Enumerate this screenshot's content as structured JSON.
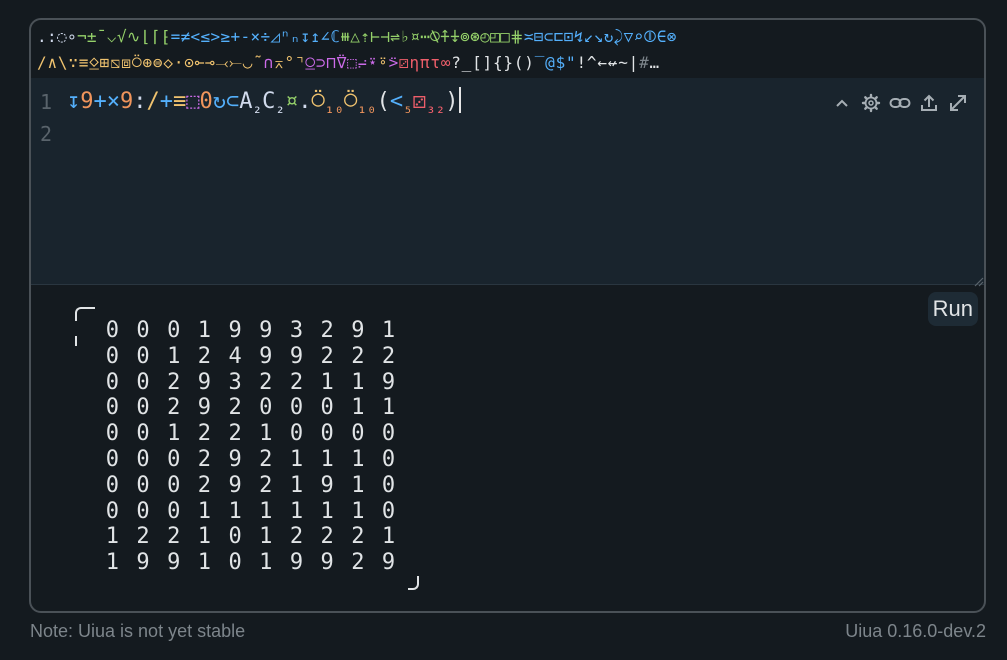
{
  "colors": {
    "number": "#f0955c",
    "monadic_function": "#95d16a",
    "dyadic_function": "#54b0fc",
    "monadic_modifier": "#f0c36f",
    "dyadic_modifier": "#cc6be9",
    "constant": "#ed5e6a",
    "stack": "#d1daec",
    "text": "#e1e4e6",
    "muted": "#7d858b"
  },
  "glyph_rows": [
    [
      {
        "c": ".",
        "k": "stack"
      },
      {
        "c": ":",
        "k": "stack"
      },
      {
        "c": "◌",
        "k": "stack"
      },
      {
        "c": "∘",
        "k": "stack"
      },
      {
        "c": "¬",
        "k": "monadic_function"
      },
      {
        "c": "±",
        "k": "monadic_function"
      },
      {
        "c": "¯",
        "k": "monadic_function"
      },
      {
        "c": "⌵",
        "k": "monadic_function"
      },
      {
        "c": "√",
        "k": "monadic_function"
      },
      {
        "c": "∿",
        "k": "monadic_function"
      },
      {
        "c": "⌊",
        "k": "monadic_function"
      },
      {
        "c": "⌈",
        "k": "monadic_function"
      },
      {
        "c": "⁅",
        "k": "monadic_function"
      },
      {
        "c": "=",
        "k": "dyadic_function"
      },
      {
        "c": "≠",
        "k": "dyadic_function"
      },
      {
        "c": "<",
        "k": "dyadic_function"
      },
      {
        "c": "≤",
        "k": "dyadic_function"
      },
      {
        "c": ">",
        "k": "dyadic_function"
      },
      {
        "c": "≥",
        "k": "dyadic_function"
      },
      {
        "c": "+",
        "k": "dyadic_function"
      },
      {
        "c": "-",
        "k": "dyadic_function"
      },
      {
        "c": "×",
        "k": "dyadic_function"
      },
      {
        "c": "÷",
        "k": "dyadic_function"
      },
      {
        "c": "◿",
        "k": "dyadic_function"
      },
      {
        "c": "ⁿ",
        "k": "dyadic_function"
      },
      {
        "c": "ₙ",
        "k": "dyadic_function"
      },
      {
        "c": "↧",
        "k": "dyadic_function"
      },
      {
        "c": "↥",
        "k": "dyadic_function"
      },
      {
        "c": "∠",
        "k": "dyadic_function"
      },
      {
        "c": "ℂ",
        "k": "dyadic_function"
      },
      {
        "c": "⧻",
        "k": "monadic_function"
      },
      {
        "c": "△",
        "k": "monadic_function"
      },
      {
        "c": "⇡",
        "k": "monadic_function"
      },
      {
        "c": "⊢",
        "k": "monadic_function"
      },
      {
        "c": "⊣",
        "k": "monadic_function"
      },
      {
        "c": "⇌",
        "k": "monadic_function"
      },
      {
        "c": "♭",
        "k": "monadic_function"
      },
      {
        "c": "¤",
        "k": "monadic_function"
      },
      {
        "c": "⋯",
        "k": "monadic_function"
      },
      {
        "c": "⍉",
        "k": "monadic_function"
      },
      {
        "c": "⍏",
        "k": "monadic_function"
      },
      {
        "c": "⍖",
        "k": "monadic_function"
      },
      {
        "c": "⊚",
        "k": "monadic_function"
      },
      {
        "c": "⊛",
        "k": "monadic_function"
      },
      {
        "c": "◴",
        "k": "monadic_function"
      },
      {
        "c": "◰",
        "k": "monadic_function"
      },
      {
        "c": "□",
        "k": "monadic_function"
      },
      {
        "c": "⋕",
        "k": "monadic_function"
      },
      {
        "c": "≍",
        "k": "dyadic_function"
      },
      {
        "c": "⊟",
        "k": "dyadic_function"
      },
      {
        "c": "⊂",
        "k": "dyadic_function"
      },
      {
        "c": "⊏",
        "k": "dyadic_function"
      },
      {
        "c": "⊡",
        "k": "dyadic_function"
      },
      {
        "c": "↯",
        "k": "dyadic_function"
      },
      {
        "c": "↙",
        "k": "dyadic_function"
      },
      {
        "c": "↘",
        "k": "dyadic_function"
      },
      {
        "c": "↻",
        "k": "dyadic_function"
      },
      {
        "c": "⤸",
        "k": "dyadic_function"
      },
      {
        "c": "▽",
        "k": "dyadic_function"
      },
      {
        "c": "⌕",
        "k": "dyadic_function"
      },
      {
        "c": "⦷",
        "k": "dyadic_function"
      },
      {
        "c": "∈",
        "k": "dyadic_function"
      },
      {
        "c": "⊗",
        "k": "dyadic_function"
      }
    ],
    [
      {
        "c": "/",
        "k": "monadic_modifier"
      },
      {
        "c": "∧",
        "k": "monadic_modifier"
      },
      {
        "c": "\\",
        "k": "monadic_modifier"
      },
      {
        "c": "∵",
        "k": "monadic_modifier"
      },
      {
        "c": "≡",
        "k": "monadic_modifier"
      },
      {
        "c": "⍚",
        "k": "monadic_modifier"
      },
      {
        "c": "⊞",
        "k": "monadic_modifier"
      },
      {
        "c": "⧅",
        "k": "monadic_modifier"
      },
      {
        "c": "⧈",
        "k": "monadic_modifier"
      },
      {
        "c": "⍥",
        "k": "monadic_modifier"
      },
      {
        "c": "⊕",
        "k": "monadic_modifier"
      },
      {
        "c": "⊜",
        "k": "monadic_modifier"
      },
      {
        "c": "◇",
        "k": "monadic_modifier"
      },
      {
        "c": "⋅",
        "k": "monadic_modifier"
      },
      {
        "c": "⊙",
        "k": "monadic_modifier"
      },
      {
        "c": "⟜",
        "k": "monadic_modifier"
      },
      {
        "c": "⊸",
        "k": "monadic_modifier"
      },
      {
        "c": "⤙",
        "k": "monadic_modifier"
      },
      {
        "c": "⤚",
        "k": "monadic_modifier"
      },
      {
        "c": "◡",
        "k": "monadic_modifier"
      },
      {
        "c": "˜",
        "k": "monadic_modifier"
      },
      {
        "c": "∩",
        "k": "dyadic_modifier"
      },
      {
        "c": "⌅",
        "k": "monadic_modifier"
      },
      {
        "c": "°",
        "k": "monadic_modifier"
      },
      {
        "c": "⌝",
        "k": "monadic_modifier"
      },
      {
        "c": "⍜",
        "k": "dyadic_modifier"
      },
      {
        "c": "⊃",
        "k": "dyadic_modifier"
      },
      {
        "c": "⊓",
        "k": "dyadic_modifier"
      },
      {
        "c": "⍢",
        "k": "dyadic_modifier"
      },
      {
        "c": "⬚",
        "k": "dyadic_modifier"
      },
      {
        "c": "⨬",
        "k": "dyadic_modifier"
      },
      {
        "c": "⍣",
        "k": "dyadic_modifier"
      },
      {
        "c": "⍤",
        "k": "monadic_modifier"
      },
      {
        "c": "⍩",
        "k": "dyadic_modifier"
      },
      {
        "c": "⚂",
        "k": "constant"
      },
      {
        "c": "η",
        "k": "constant"
      },
      {
        "c": "π",
        "k": "constant"
      },
      {
        "c": "τ",
        "k": "constant"
      },
      {
        "c": "∞",
        "k": "constant"
      },
      {
        "c": "?",
        "k": "text"
      },
      {
        "c": "_",
        "k": "text"
      },
      {
        "c": "[",
        "k": "text"
      },
      {
        "c": "]",
        "k": "text"
      },
      {
        "c": "{",
        "k": "text"
      },
      {
        "c": "}",
        "k": "text"
      },
      {
        "c": "(",
        "k": "text"
      },
      {
        "c": ")",
        "k": "text"
      },
      {
        "c": "‾",
        "k": "dyadic_function"
      },
      {
        "c": "@",
        "k": "dyadic_function"
      },
      {
        "c": "$",
        "k": "dyadic_function"
      },
      {
        "c": "\"",
        "k": "dyadic_function"
      },
      {
        "c": "!",
        "k": "text"
      },
      {
        "c": "^",
        "k": "text"
      },
      {
        "c": "←",
        "k": "text"
      },
      {
        "c": "↚",
        "k": "text"
      },
      {
        "c": "~",
        "k": "text"
      },
      {
        "c": "|",
        "k": "text"
      },
      {
        "c": "#",
        "k": "muted"
      },
      {
        "c": "…",
        "k": "text"
      }
    ]
  ],
  "line_numbers": [
    "1",
    "2"
  ],
  "code_tokens": [
    {
      "t": "↧",
      "k": "dyadic_function"
    },
    {
      "t": "9",
      "k": "number"
    },
    {
      "t": "+",
      "k": "dyadic_function"
    },
    {
      "t": "×",
      "k": "dyadic_function"
    },
    {
      "t": "9",
      "k": "number"
    },
    {
      "t": ":",
      "k": "stack"
    },
    {
      "t": "/",
      "k": "monadic_modifier"
    },
    {
      "t": "+",
      "k": "dyadic_function"
    },
    {
      "t": "≡",
      "k": "monadic_modifier"
    },
    {
      "t": "⬚",
      "k": "dyadic_modifier"
    },
    {
      "t": "0",
      "k": "number"
    },
    {
      "t": "↻",
      "k": "dyadic_function"
    },
    {
      "t": "⊂",
      "k": "dyadic_function"
    },
    {
      "t": "A",
      "k": "stack"
    },
    {
      "t": "₂",
      "k": "stack",
      "sub": true
    },
    {
      "t": "C",
      "k": "stack"
    },
    {
      "t": "₂",
      "k": "stack",
      "sub": true
    },
    {
      "t": "¤",
      "k": "monadic_function"
    },
    {
      "t": ".",
      "k": "stack"
    },
    {
      "t": "⍥",
      "k": "monadic_modifier"
    },
    {
      "t": "₁₀",
      "k": "number",
      "sub": true
    },
    {
      "t": "⍥",
      "k": "monadic_modifier"
    },
    {
      "t": "₁₀",
      "k": "number",
      "sub": true
    },
    {
      "t": "(",
      "k": "text"
    },
    {
      "t": "<",
      "k": "dyadic_function"
    },
    {
      "t": "₅",
      "k": "number",
      "sub": true
    },
    {
      "t": "⚂",
      "k": "constant"
    },
    {
      "t": "₃₂",
      "k": "constant",
      "sub": true
    },
    {
      "t": ")",
      "k": "text"
    }
  ],
  "icons": [
    "chevron-up-icon",
    "gear-icon",
    "link-icon",
    "upload-icon",
    "expand-icon"
  ],
  "run_label": "Run",
  "output_matrix": [
    [
      "0",
      "0",
      "0",
      "1",
      "9",
      "9",
      "3",
      "2",
      "9",
      "1"
    ],
    [
      "0",
      "0",
      "1",
      "2",
      "4",
      "9",
      "9",
      "2",
      "2",
      "2"
    ],
    [
      "0",
      "0",
      "2",
      "9",
      "3",
      "2",
      "2",
      "1",
      "1",
      "9"
    ],
    [
      "0",
      "0",
      "2",
      "9",
      "2",
      "0",
      "0",
      "0",
      "1",
      "1"
    ],
    [
      "0",
      "0",
      "1",
      "2",
      "2",
      "1",
      "0",
      "0",
      "0",
      "0"
    ],
    [
      "0",
      "0",
      "0",
      "2",
      "9",
      "2",
      "1",
      "1",
      "1",
      "0"
    ],
    [
      "0",
      "0",
      "0",
      "2",
      "9",
      "2",
      "1",
      "9",
      "1",
      "0"
    ],
    [
      "0",
      "0",
      "0",
      "1",
      "1",
      "1",
      "1",
      "1",
      "1",
      "0"
    ],
    [
      "1",
      "2",
      "2",
      "1",
      "0",
      "1",
      "2",
      "2",
      "2",
      "1"
    ],
    [
      "1",
      "9",
      "9",
      "1",
      "0",
      "1",
      "9",
      "9",
      "2",
      "9"
    ]
  ],
  "footer": {
    "note": "Note: Uiua is not yet stable",
    "version": "Uiua 0.16.0-dev.2"
  }
}
